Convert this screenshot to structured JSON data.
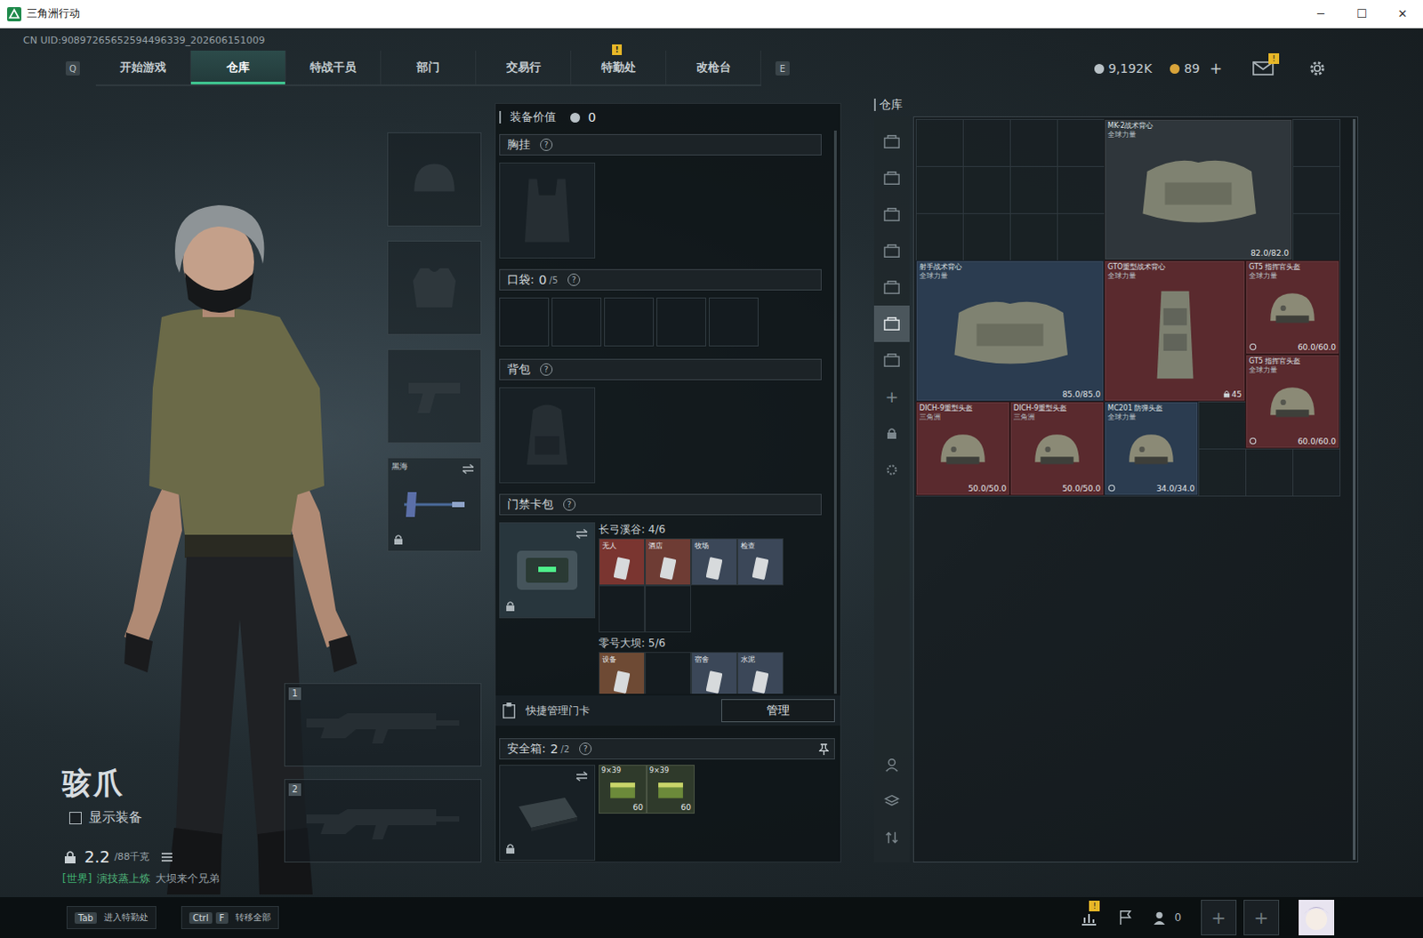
{
  "window": {
    "title": "三角洲行动",
    "controls": [
      "─",
      "☐",
      "✕"
    ]
  },
  "uid": "CN UID:90897265652594496339_202606151009",
  "nav": {
    "prev_key": "Q",
    "next_key": "E",
    "tabs": [
      {
        "label": "开始游戏",
        "selected": false,
        "badge": ""
      },
      {
        "label": "仓库",
        "selected": true,
        "badge": ""
      },
      {
        "label": "特战干员",
        "selected": false,
        "badge": ""
      },
      {
        "label": "部门",
        "selected": false,
        "badge": ""
      },
      {
        "label": "交易行",
        "selected": false,
        "badge": ""
      },
      {
        "label": "特勤处",
        "selected": false,
        "badge": "!"
      },
      {
        "label": "改枪台",
        "selected": false,
        "badge": ""
      }
    ]
  },
  "currency": [
    {
      "value": "9,192K",
      "action": "",
      "color": "#b9c2c7"
    },
    {
      "value": "89",
      "action": "+",
      "color": "#d9a43a"
    }
  ],
  "header_icons": {
    "mail_badge": "!"
  },
  "operator": {
    "name": "骇爪",
    "show_equipment": {
      "label": "显示装备",
      "checked": false
    },
    "weight": "2.2",
    "weight_max": "/88千克",
    "chat": {
      "channel": "[世界]",
      "sender": "演技蒸上炼",
      "message": "大坝来个兄弟"
    }
  },
  "gear_slots": [
    {
      "kind": "helmet",
      "label": "",
      "locked": false,
      "swappable": false
    },
    {
      "kind": "armor",
      "label": "",
      "locked": false,
      "swappable": false
    },
    {
      "kind": "pistol",
      "label": "",
      "locked": false,
      "swappable": false
    },
    {
      "kind": "melee",
      "label": "黑海",
      "locked": true,
      "swappable": true
    }
  ],
  "weapon_slots": [
    {
      "number": "1"
    },
    {
      "number": "2"
    }
  ],
  "loadout": {
    "value_label": "装备价值",
    "value": "0",
    "chest": {
      "label": "胸挂",
      "help": "?"
    },
    "pockets": {
      "label": "口袋:",
      "count": "0",
      "capacity": "/5",
      "help": "?",
      "slots": [
        {
          "filled": false
        },
        {
          "filled": false
        },
        {
          "filled": false
        },
        {
          "filled": false
        },
        {
          "filled": false
        }
      ]
    },
    "backpack": {
      "label": "背包",
      "help": "?"
    },
    "keycard_bag": {
      "label": "门禁卡包",
      "help": "?",
      "locked": true,
      "groups": [
        {
          "title": "长弓溪谷: 4/6",
          "cards": [
            {
              "label": "无人",
              "filled": true,
              "color": "#7a3530"
            },
            {
              "label": "酒店",
              "filled": true,
              "color": "#6e3c34"
            },
            {
              "label": "牧场",
              "filled": true,
              "color": "#3b4758"
            },
            {
              "label": "检查",
              "filled": true,
              "color": "#3b4758"
            },
            {
              "label": "",
              "filled": false,
              "color": null
            },
            {
              "label": "",
              "filled": false,
              "color": null
            }
          ]
        },
        {
          "title": "零号大坝: 5/6",
          "cards": [
            {
              "label": "设备",
              "filled": true,
              "color": "#6e4a34"
            },
            {
              "label": "",
              "filled": false,
              "color": null
            },
            {
              "label": "宿舍",
              "filled": true,
              "color": "#3b4758"
            },
            {
              "label": "水泥",
              "filled": true,
              "color": "#3b4758"
            }
          ]
        }
      ]
    },
    "quick_manage": {
      "label": "快捷管理门卡",
      "button": "管理"
    },
    "safe_box": {
      "label": "安全箱:",
      "count": "2",
      "capacity": "/2",
      "help": "?",
      "pinned": true,
      "locked": true,
      "items": [
        {
          "name": "9×39",
          "count": "60"
        },
        {
          "name": "9×39",
          "count": "60"
        }
      ]
    }
  },
  "warehouse": {
    "title": "仓库",
    "sidebar": [
      {
        "kind": "tab",
        "glyph": "",
        "selected": false
      },
      {
        "kind": "tab",
        "glyph": "",
        "selected": false
      },
      {
        "kind": "tab",
        "glyph": "",
        "selected": false
      },
      {
        "kind": "tab",
        "glyph": "",
        "selected": false
      },
      {
        "kind": "tab",
        "glyph": "",
        "selected": false
      },
      {
        "kind": "tab",
        "glyph": "",
        "selected": true
      },
      {
        "kind": "tab",
        "glyph": "",
        "selected": false
      },
      {
        "kind": "add",
        "glyph": "+",
        "selected": false
      },
      {
        "kind": "lock",
        "glyph": "",
        "selected": false
      },
      {
        "kind": "settings",
        "glyph": "",
        "selected": false
      }
    ],
    "sidebar_bottom": [
      {
        "kind": "profile"
      },
      {
        "kind": "layers"
      },
      {
        "kind": "sort"
      }
    ],
    "items": [
      {
        "name": "MK-2战术背心",
        "faction": "全球力量",
        "durability": "82.0/82.0",
        "kind": "vest",
        "color": "#2f363b",
        "bound": false,
        "locked": false
      },
      {
        "name": "射手战术背心",
        "faction": "全球力量",
        "durability": "85.0/85.0",
        "kind": "vest",
        "color": "#2b3c50",
        "bound": false,
        "locked": false
      },
      {
        "name": "GTO重型战术背心",
        "faction": "全球力量",
        "durability": "45",
        "kind": "rig",
        "color": "#5a2a2e",
        "bound": false,
        "locked": true
      },
      {
        "name": "GT5 指挥官头盔",
        "faction": "全球力量",
        "durability": "60.0/60.0",
        "kind": "helmet",
        "color": "#5a2a2e",
        "bound": true,
        "locked": false
      },
      {
        "name": "GT5 指挥官头盔",
        "faction": "全球力量",
        "durability": "60.0/60.0",
        "kind": "helmet",
        "color": "#5a2a2e",
        "bound": true,
        "locked": false
      },
      {
        "name": "DICH-9重型头盔",
        "faction": "三角洲",
        "durability": "50.0/50.0",
        "kind": "helmet",
        "color": "#5a2a2e",
        "bound": false,
        "locked": false
      },
      {
        "name": "DICH-9重型头盔",
        "faction": "三角洲",
        "durability": "50.0/50.0",
        "kind": "helmet",
        "color": "#5a2a2e",
        "bound": false,
        "locked": false
      },
      {
        "name": "MC201 防弹头盔",
        "faction": "全球力量",
        "durability": "34.0/34.0",
        "kind": "helmet",
        "color": "#2b3c50",
        "bound": true,
        "locked": false
      }
    ]
  },
  "bottom_bar": {
    "actions": [
      {
        "keys": [
          "Tab"
        ],
        "label": "进入特勤处"
      },
      {
        "keys": [
          "Ctrl",
          "F"
        ],
        "label": "转移全部"
      }
    ],
    "stats_badge": "!",
    "friends_count": "0",
    "party_slots": [
      "+",
      "+"
    ]
  }
}
